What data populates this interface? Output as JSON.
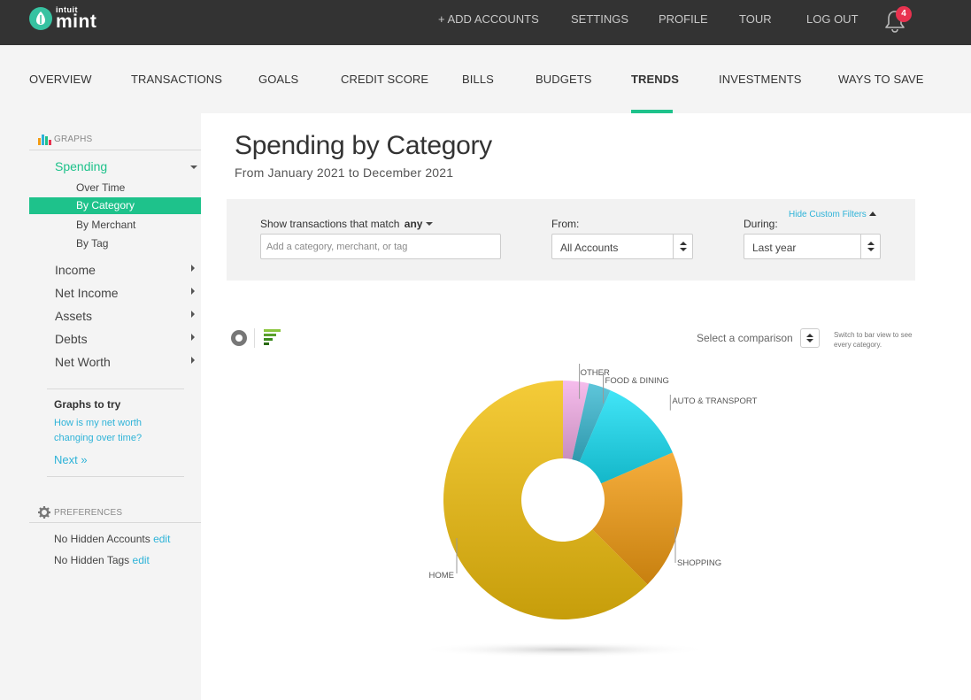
{
  "brand": {
    "small": "intuit",
    "big": "mint"
  },
  "topnav": [
    {
      "label": "+ ADD ACCOUNTS"
    },
    {
      "label": "SETTINGS"
    },
    {
      "label": "PROFILE"
    },
    {
      "label": "TOUR"
    },
    {
      "label": "LOG OUT"
    }
  ],
  "notifications": {
    "count": "4"
  },
  "mainnav": [
    {
      "label": "OVERVIEW"
    },
    {
      "label": "TRANSACTIONS"
    },
    {
      "label": "GOALS"
    },
    {
      "label": "CREDIT SCORE"
    },
    {
      "label": "BILLS"
    },
    {
      "label": "BUDGETS"
    },
    {
      "label": "TRENDS",
      "active": true
    },
    {
      "label": "INVESTMENTS"
    },
    {
      "label": "WAYS TO SAVE"
    }
  ],
  "sidebar": {
    "graphs_heading": "GRAPHS",
    "spending": "Spending",
    "spending_subs": [
      "Over Time",
      "By Category",
      "By Merchant",
      "By Tag"
    ],
    "items": [
      "Income",
      "Net Income",
      "Assets",
      "Debts",
      "Net Worth"
    ],
    "graphs_to_try": "Graphs to try",
    "try_link": "How is my net worth changing over time?",
    "next": "Next »",
    "preferences_heading": "PREFERENCES",
    "hidden_accounts": "No Hidden Accounts",
    "hidden_tags": "No Hidden Tags",
    "edit": "edit"
  },
  "page": {
    "title": "Spending by Category",
    "subtitle": "From January 2021 to December 2021"
  },
  "filters": {
    "hide_custom": "Hide Custom Filters",
    "match_label": "Show transactions that match",
    "match_value": "any",
    "search_placeholder": "Add a category, merchant, or tag",
    "from_label": "From:",
    "from_value": "All Accounts",
    "during_label": "During:",
    "during_value": "Last year"
  },
  "comparison": {
    "label": "Select a comparison",
    "note": "Switch to bar view to see every category."
  },
  "colors": {
    "accent": "#1ec28b",
    "link": "#2eb3d8",
    "topbar": "#333333",
    "badge": "#e8324f"
  },
  "chart_data": {
    "type": "pie",
    "donut": true,
    "title": "",
    "categories": [
      "OTHER",
      "FOOD & DINING",
      "AUTO & TRANSPORT",
      "SHOPPING",
      "HOME"
    ],
    "values": [
      3.5,
      3,
      12,
      19,
      62.5
    ],
    "unit": "percent",
    "colors": [
      "#f4aee8",
      "#3ab9d2",
      "#18dff5",
      "#f39c12",
      "#f2c00d"
    ]
  }
}
